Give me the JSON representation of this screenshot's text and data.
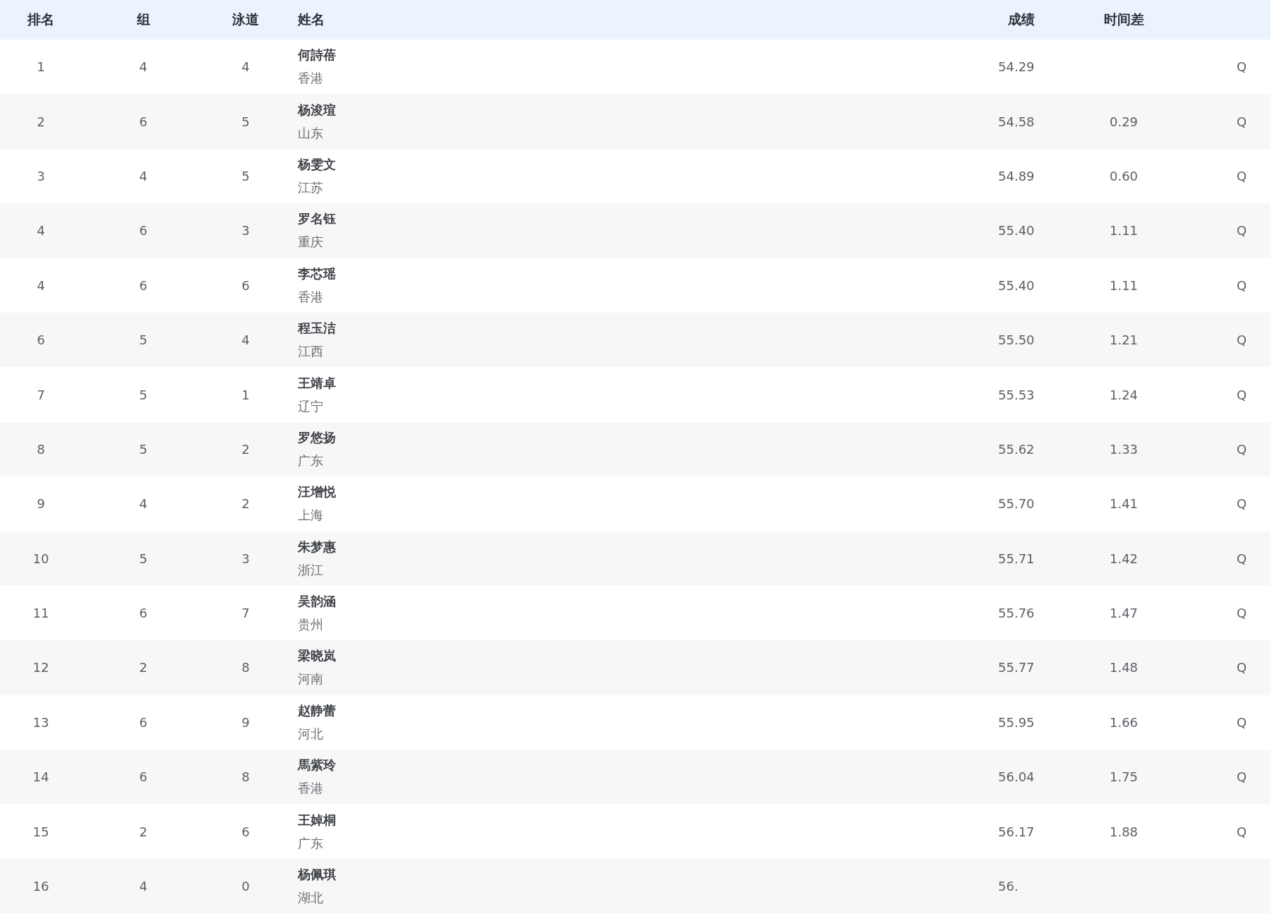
{
  "table": {
    "columns": [
      "排名",
      "组",
      "泳道",
      "姓名",
      "成绩",
      "时间差"
    ],
    "rows": [
      {
        "rank": "1",
        "group": "4",
        "lane": "4",
        "name": "何詩蓓",
        "team": "香港",
        "result": "54.29",
        "qualifier": "Q"
      },
      {
        "rank": "2",
        "group": "6",
        "lane": "5",
        "name": "杨浚瑄",
        "team": "山东",
        "result": "54.58",
        "time_diff": "0.29",
        "qualifier": "Q"
      },
      {
        "rank": "3",
        "group": "4",
        "lane": "5",
        "name": "杨雯文",
        "team": "江苏",
        "result": "54.89",
        "time_diff": "0.60",
        "qualifier": "Q"
      },
      {
        "rank": "4",
        "group": "6",
        "lane": "3",
        "name": "罗名钰",
        "team": "重庆",
        "result": "55.40",
        "time_diff": "1.11",
        "qualifier": "Q"
      },
      {
        "rank": "4",
        "group": "6",
        "lane": "6",
        "name": "李芯瑶",
        "team": "香港",
        "result": "55.40",
        "time_diff": "1.11",
        "qualifier": "Q"
      },
      {
        "rank": "6",
        "group": "5",
        "lane": "4",
        "name": "程玉洁",
        "team": "江西",
        "result": "55.50",
        "time_diff": "1.21",
        "qualifier": "Q"
      },
      {
        "rank": "7",
        "group": "5",
        "lane": "1",
        "name": "王靖卓",
        "team": "辽宁",
        "result": "55.53",
        "time_diff": "1.24",
        "qualifier": "Q"
      },
      {
        "rank": "8",
        "group": "5",
        "lane": "2",
        "name": "罗悠扬",
        "team": "广东",
        "result": "55.62",
        "time_diff": "1.33",
        "qualifier": "Q"
      },
      {
        "rank": "9",
        "group": "4",
        "lane": "2",
        "name": "汪增悦",
        "team": "上海",
        "result": "55.70",
        "time_diff": "1.41",
        "qualifier": "Q"
      },
      {
        "rank": "10",
        "group": "5",
        "lane": "3",
        "name": "朱梦惠",
        "team": "浙江",
        "result": "55.71",
        "time_diff": "1.42",
        "qualifier": "Q"
      },
      {
        "rank": "11",
        "group": "6",
        "lane": "7",
        "name": "吴韵涵",
        "team": "贵州",
        "result": "55.76",
        "time_diff": "1.47",
        "qualifier": "Q"
      },
      {
        "rank": "12",
        "group": "2",
        "lane": "8",
        "name": "梁晓岚",
        "team": "河南",
        "result": "55.77",
        "time_diff": "1.48",
        "qualifier": "Q"
      },
      {
        "rank": "13",
        "group": "6",
        "lane": "9",
        "name": "赵静蕾",
        "team": "河北",
        "result": "55.95",
        "time_diff": "1.66",
        "qualifier": "Q"
      },
      {
        "rank": "14",
        "group": "6",
        "lane": "8",
        "name": "馬紫玲",
        "team": "香港",
        "result": "56.04",
        "time_diff": "1.75",
        "qualifier": "Q"
      },
      {
        "rank": "15",
        "group": "2",
        "lane": "6",
        "name": "王婥桐",
        "team": "广东",
        "result": "56.17",
        "time_diff": "1.88",
        "qualifier": "Q"
      },
      {
        "rank": "16",
        "group": "4",
        "lane": "0",
        "name": "杨佩琪",
        "team": "湖北",
        "result": "56."
      }
    ]
  }
}
